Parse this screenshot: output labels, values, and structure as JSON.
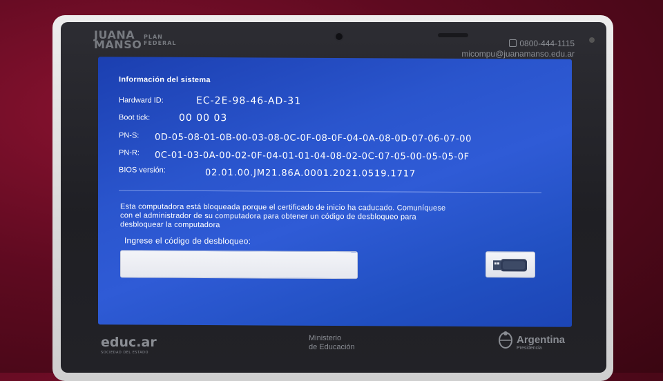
{
  "brand": {
    "logo_line1": "JUANA",
    "logo_line2": "MANSO",
    "plan_line1": "PLAN",
    "plan_line2": "FEDERAL",
    "phone": "0800-444-1115",
    "email": "micompu@juanamanso.edu.ar"
  },
  "screen": {
    "title": "Información del sistema",
    "hardware_id_label": "Hardward ID:",
    "hardware_id_value": "EC-2E-98-46-AD-31",
    "boot_tick_label": "Boot tick:",
    "boot_tick_value": "00 00 03",
    "pns_label": "PN-S:",
    "pns_value": "0D-05-08-01-0B-00-03-08-0C-0F-08-0F-04-0A-08-0D-07-06-07-00",
    "pnr_label": "PN-R:",
    "pnr_value": "0C-01-03-0A-00-02-0F-04-01-01-04-08-02-0C-07-05-00-05-05-0F",
    "bios_label": "BIOS versión:",
    "bios_value": "02.01.00.JM21.86A.0001.2021.0519.1717",
    "message_line1": "Esta computadora está bloqueada porque el certificado de inicio ha caducado. Comuníquese",
    "message_line2": "con el administrador de su computadora para obtener un código de desbloqueo para",
    "message_line3": "desbloquear la computadora",
    "prompt": "Ingrese el código de desbloqueo:",
    "unlock_code_value": "",
    "usb_icon": "usb-drive-icon"
  },
  "footer": {
    "educ_logo": "educ.ar",
    "educ_sub": "SOCIEDAD DEL ESTADO",
    "ministerio_line1": "Ministerio",
    "ministerio_line2": "de Educación",
    "argentina": "Argentina",
    "argentina_sub": "Presidencia"
  },
  "colors": {
    "screen_blue": "#2a55cd",
    "bezel": "#222227",
    "background": "#5e0a20"
  }
}
